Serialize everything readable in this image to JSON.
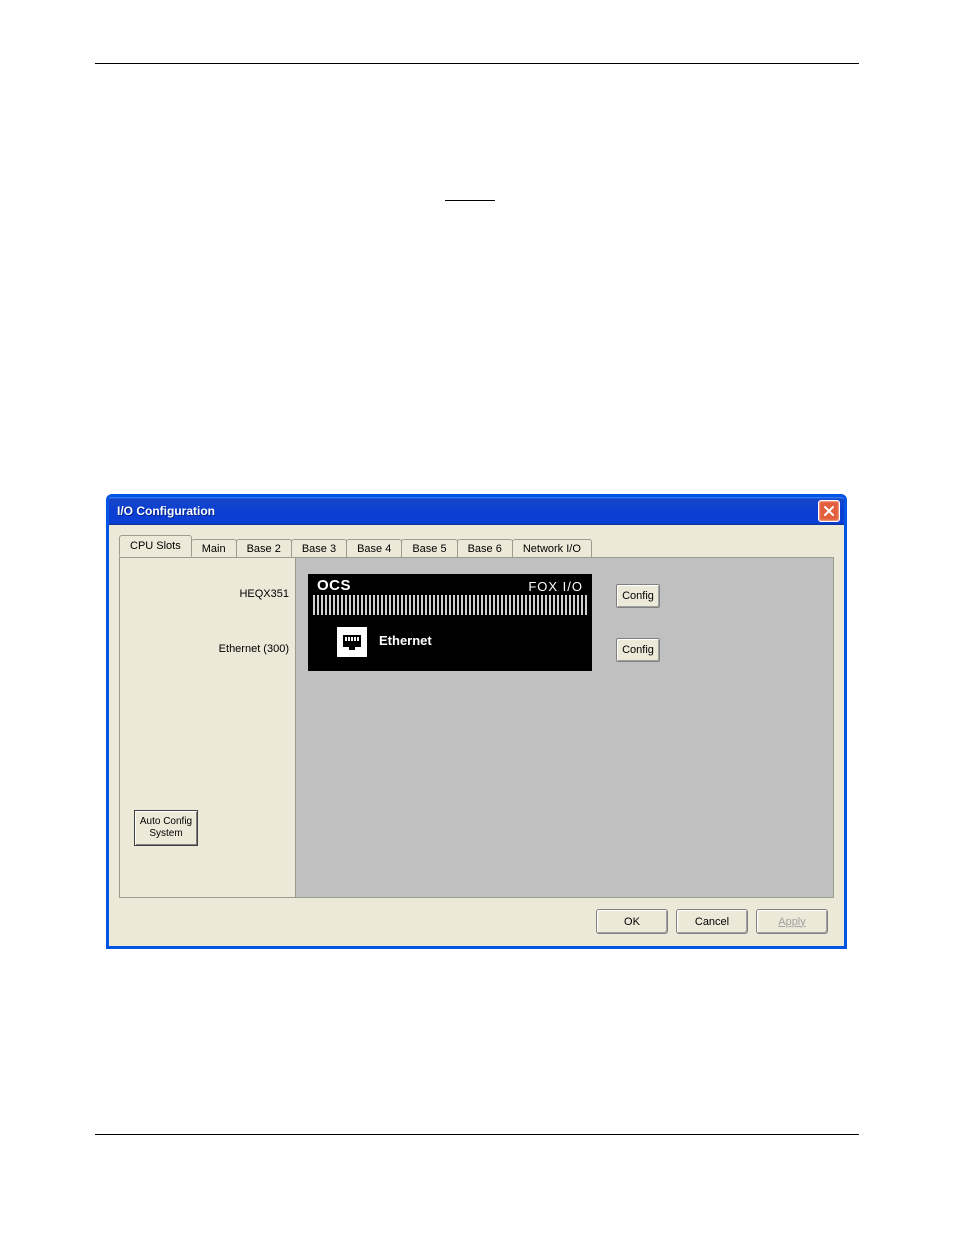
{
  "window": {
    "title": "I/O Configuration"
  },
  "tabs": [
    {
      "label": "CPU Slots",
      "active": true
    },
    {
      "label": "Main",
      "active": false
    },
    {
      "label": "Base 2",
      "active": false
    },
    {
      "label": "Base 3",
      "active": false
    },
    {
      "label": "Base 4",
      "active": false
    },
    {
      "label": "Base 5",
      "active": false
    },
    {
      "label": "Base 6",
      "active": false
    },
    {
      "label": "Network I/O",
      "active": false
    }
  ],
  "rows": [
    {
      "label": "HEQX351",
      "config": "Config"
    },
    {
      "label": "Ethernet (300)",
      "config": "Config"
    }
  ],
  "module_top": {
    "ocs": "OCS",
    "product": "FOX I/O"
  },
  "module_bottom": {
    "label": "Ethernet"
  },
  "auto_config_label": "Auto Config System",
  "dialog_buttons": {
    "ok": "OK",
    "cancel": "Cancel",
    "apply": "Apply"
  }
}
